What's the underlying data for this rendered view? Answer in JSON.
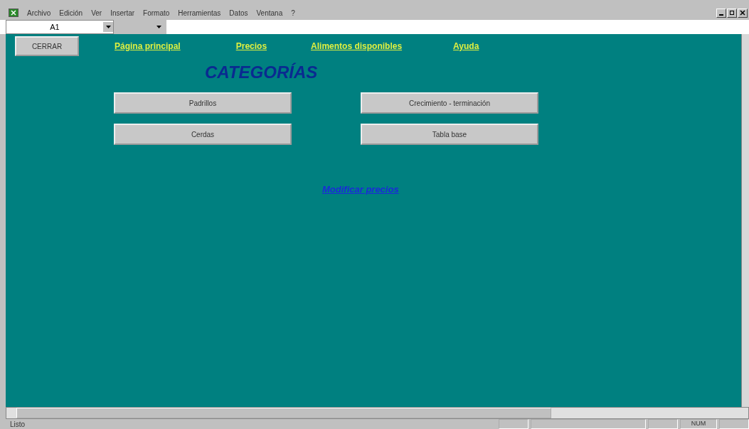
{
  "menu_bar": {
    "items": [
      "Archivo",
      "Edición",
      "Ver",
      "Insertar",
      "Formato",
      "Herramientas",
      "Datos",
      "Ventana",
      "?"
    ]
  },
  "formula_bar": {
    "cell_reference": "A1"
  },
  "sheet": {
    "close_button": "CERRAR",
    "nav_links": [
      "Página principal",
      "Precios",
      "Alimentos disponibles",
      "Ayuda"
    ],
    "title": "CATEGORÍAS",
    "category_buttons": [
      [
        "Padrillos",
        "Crecimiento - terminación"
      ],
      [
        "Cerdas",
        "Tabla base"
      ]
    ],
    "price_link": "Modificar precios"
  },
  "status_bar": {
    "status": "Listo",
    "indicator": "NUM"
  }
}
